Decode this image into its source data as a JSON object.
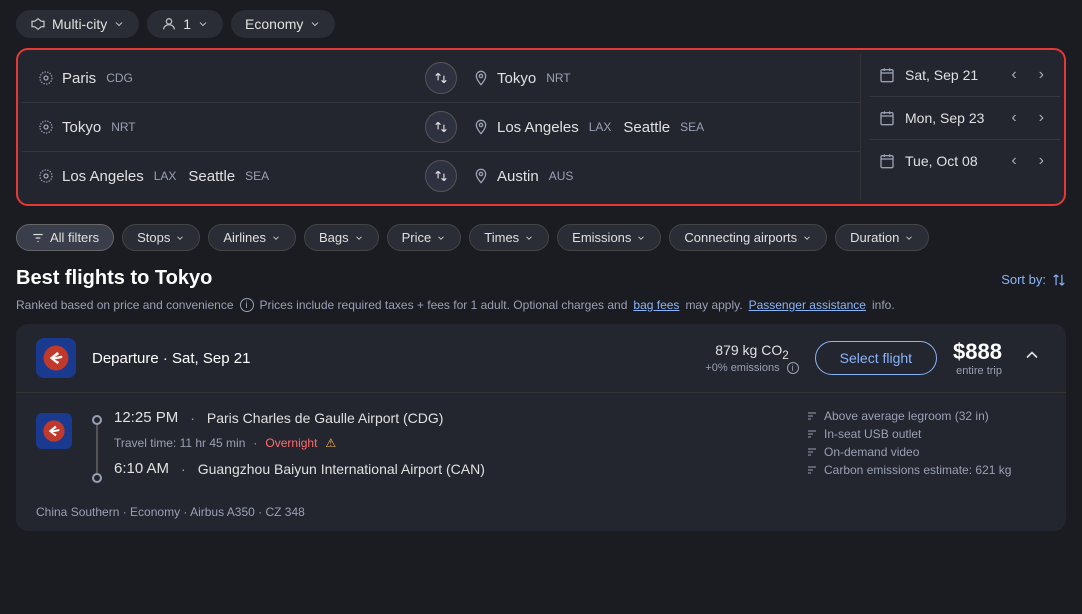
{
  "topbar": {
    "trip_type": "Multi-city",
    "passengers": "1",
    "cabin": "Economy"
  },
  "search_form": {
    "rows": [
      {
        "origin": "Paris",
        "origin_code": "CDG",
        "destination": "Tokyo",
        "destination_code": "NRT",
        "date": "Sat, Sep 21"
      },
      {
        "origin": "Tokyo",
        "origin_code": "NRT",
        "destination": "Los Angeles",
        "destination_code": "LAX",
        "destination_extra": "Seattle",
        "destination_extra_code": "SEA",
        "date": "Mon, Sep 23"
      },
      {
        "origin": "Los Angeles",
        "origin_code": "LAX",
        "origin_extra": "Seattle",
        "origin_extra_code": "SEA",
        "destination": "Austin",
        "destination_code": "AUS",
        "date": "Tue, Oct 08"
      }
    ]
  },
  "filters": {
    "all_filters_label": "All filters",
    "stops_label": "Stops",
    "airlines_label": "Airlines",
    "bags_label": "Bags",
    "price_label": "Price",
    "times_label": "Times",
    "emissions_label": "Emissions",
    "connecting_airports_label": "Connecting airports",
    "duration_label": "Duration"
  },
  "results": {
    "title": "Best flights to Tokyo",
    "subtitle_ranked": "Ranked based on price and convenience",
    "subtitle_prices": "Prices include required taxes + fees for 1 adult. Optional charges and",
    "bag_fees_link": "bag fees",
    "subtitle_may_apply": "may apply.",
    "passenger_assistance_link": "Passenger assistance",
    "subtitle_info": "info.",
    "sort_by_label": "Sort by:"
  },
  "flight_card": {
    "departure_label": "Departure",
    "departure_date": "Sat, Sep 21",
    "co2_value": "879 kg CO₂",
    "co2_sub": "+0% emissions",
    "select_button_label": "Select flight",
    "price": "$888",
    "price_sub": "entire trip",
    "segments": [
      {
        "depart_time": "12:25 PM",
        "depart_airport": "Paris Charles de Gaulle Airport (CDG)",
        "travel_time": "Travel time: 11 hr 45 min",
        "overnight_label": "Overnight",
        "arrive_time": "6:10 AM",
        "arrive_airport": "Guangzhou Baiyun International Airport (CAN)"
      }
    ],
    "amenities": [
      "Above average legroom (32 in)",
      "In-seat USB outlet",
      "On-demand video",
      "Carbon emissions estimate: 621 kg"
    ],
    "footer": "China Southern · Economy · Airbus A350 · CZ 348"
  }
}
